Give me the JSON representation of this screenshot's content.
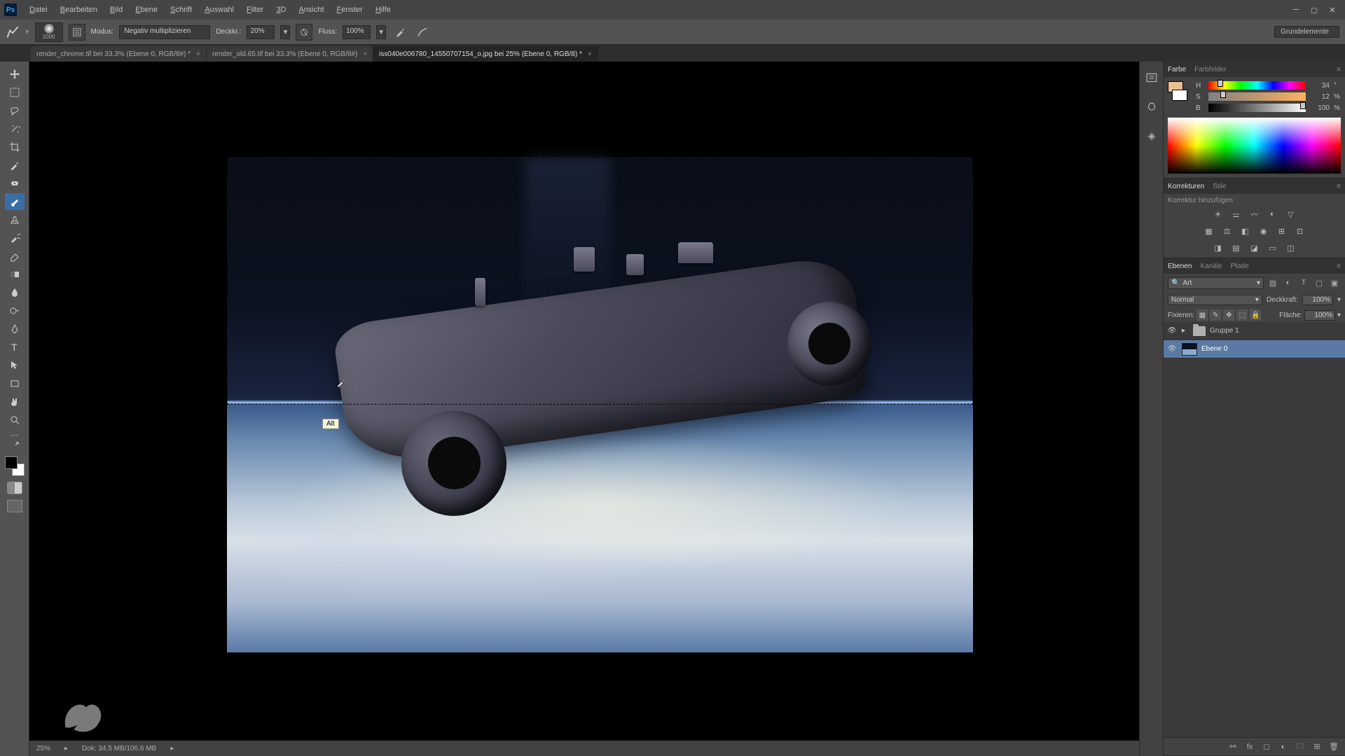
{
  "menu": {
    "items": [
      "Datei",
      "Bearbeiten",
      "Bild",
      "Ebene",
      "Schrift",
      "Auswahl",
      "Filter",
      "3D",
      "Ansicht",
      "Fenster",
      "Hilfe"
    ]
  },
  "options": {
    "brush_size": "1000",
    "mode_label": "Modus:",
    "mode_value": "Negativ multiplizieren",
    "opacity_label": "Deckkr.:",
    "opacity_value": "20%",
    "flow_label": "Fluss:",
    "flow_value": "100%",
    "workspace": "Grundelemente"
  },
  "tabs": [
    {
      "title": "render_chrome.tif bei 33.3% (Ebene 0, RGB/8#) *",
      "active": false
    },
    {
      "title": "render_old.65.tif bei 33.3% (Ebene 0, RGB/8#)",
      "active": false
    },
    {
      "title": "iss040e006780_14550707154_o.jpg bei 25%  (Ebene 0, RGB/8) *",
      "active": true
    }
  ],
  "tooltip": {
    "alt": "Alt"
  },
  "status": {
    "zoom": "25%",
    "docsize_label": "Dok:",
    "docsize": "34.5 MB/106.6 MB"
  },
  "color_panel": {
    "tab1": "Farbe",
    "tab2": "Farbfelder",
    "h": {
      "label": "H",
      "value": "34",
      "unit": "°",
      "pos": 9
    },
    "s": {
      "label": "S",
      "value": "12",
      "unit": "%",
      "pos": 12
    },
    "b": {
      "label": "B",
      "value": "100",
      "unit": "%",
      "pos": 100
    }
  },
  "adjustments_panel": {
    "tab1": "Korrekturen",
    "tab2": "Stile",
    "hint": "Korrektur hinzufügen"
  },
  "layers_panel": {
    "tab1": "Ebenen",
    "tab2": "Kanäle",
    "tab3": "Pfade",
    "kind_label": "Art",
    "blend_mode": "Normal",
    "opacity_label": "Deckkraft:",
    "opacity_value": "100%",
    "lock_label": "Fixieren:",
    "fill_label": "Fläche:",
    "fill_value": "100%",
    "layers": [
      {
        "name": "Gruppe 1",
        "type": "group",
        "visible": true
      },
      {
        "name": "Ebene 0",
        "type": "layer",
        "visible": true,
        "selected": true
      }
    ]
  }
}
